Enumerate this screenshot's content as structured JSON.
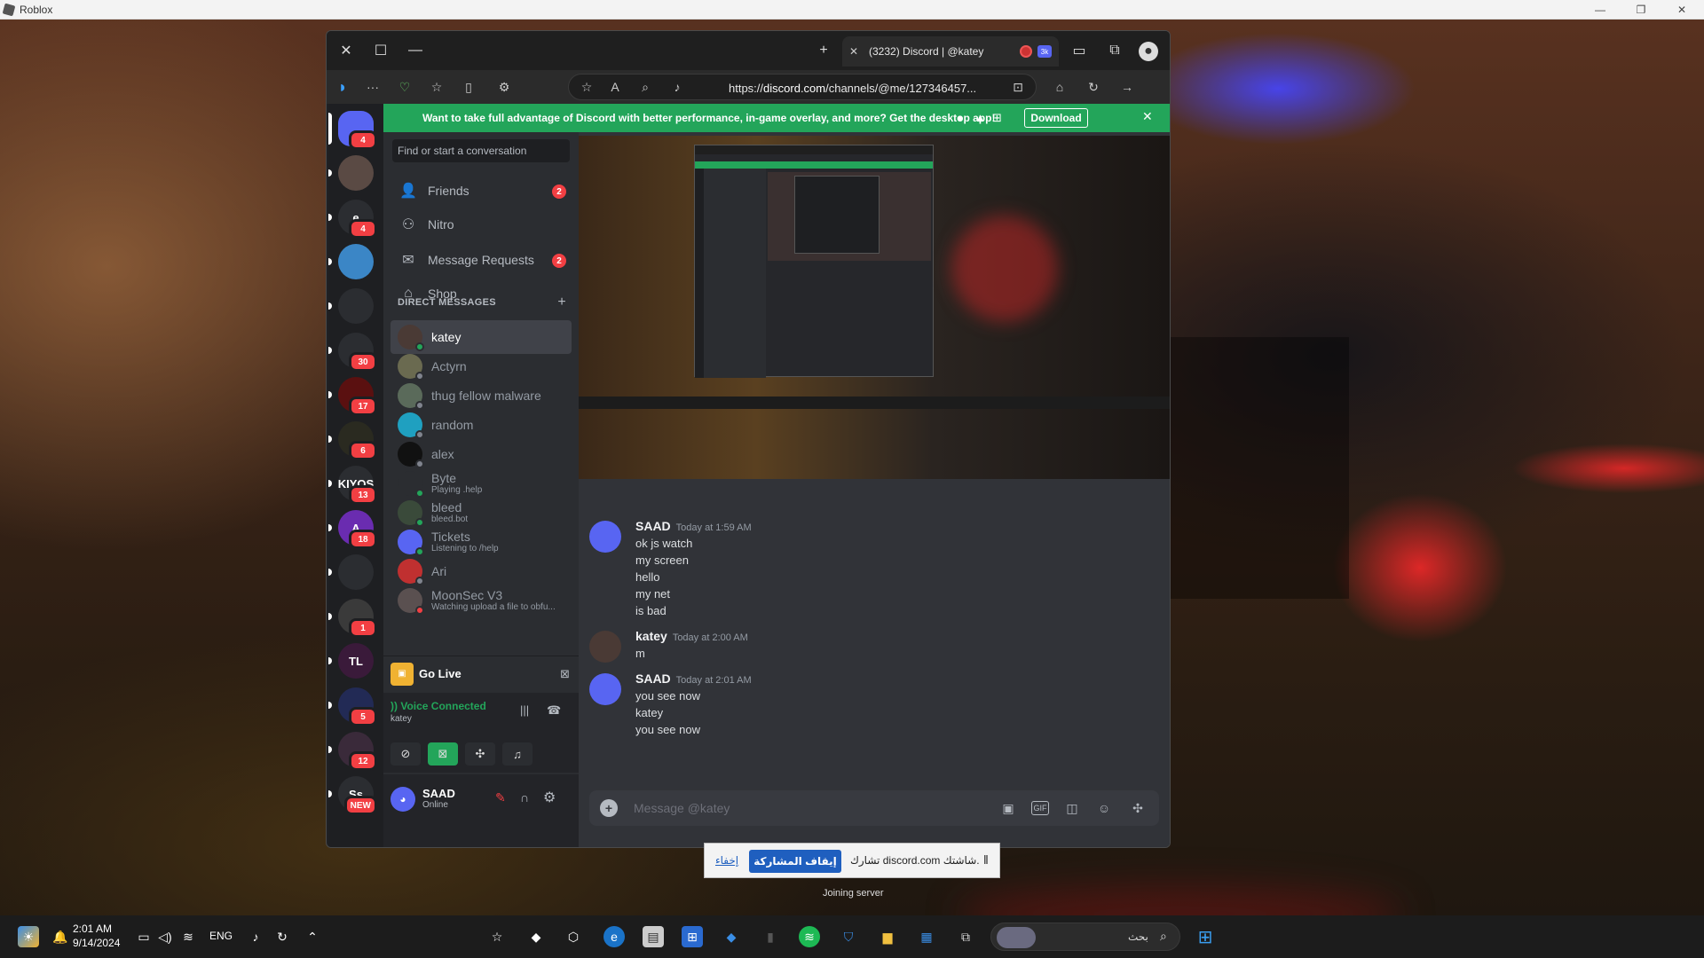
{
  "roblox": {
    "title": "Roblox"
  },
  "browser": {
    "tab_title": "(3232) Discord | @katey",
    "url_prefix": "https://",
    "url_domain": "discord.com",
    "url_rest": "/channels/@me/127346457..."
  },
  "banner": {
    "text": "Want to take full advantage of Discord with better performance, in-game overlay, and more? Get the desktop app!",
    "download": "Download"
  },
  "guilds": [
    {
      "label": "",
      "badge": "4",
      "color": "#5865f2"
    },
    {
      "label": "",
      "badge": "",
      "color": "#5a4a44"
    },
    {
      "label": "e",
      "badge": "4",
      "color": "#2b2d31"
    },
    {
      "label": "",
      "badge": "",
      "color": "#3b86c6"
    },
    {
      "label": "",
      "badge": "",
      "color": "#2b2d31"
    },
    {
      "label": "",
      "badge": "30",
      "color": "#2b2d31"
    },
    {
      "label": "",
      "badge": "17",
      "color": "#5a1010"
    },
    {
      "label": "",
      "badge": "6",
      "color": "#2a2a20"
    },
    {
      "label": "KIYOS",
      "badge": "13",
      "color": "#2b2d31"
    },
    {
      "label": "A",
      "badge": "18",
      "color": "#6a2cb0"
    },
    {
      "label": "",
      "badge": "",
      "color": "#2b2d31"
    },
    {
      "label": "",
      "badge": "1",
      "color": "#3a3a3a"
    },
    {
      "label": "TL",
      "badge": "",
      "color": "#3a1a3a"
    },
    {
      "label": "",
      "badge": "5",
      "color": "#222a55"
    },
    {
      "label": "",
      "badge": "12",
      "color": "#3a2a3a"
    },
    {
      "label": "Ss",
      "badge": "NEW",
      "color": "#2b2d31"
    }
  ],
  "sidebar": {
    "search_placeholder": "Find or start a conversation",
    "nav": [
      {
        "label": "Friends",
        "badge": "2"
      },
      {
        "label": "Nitro",
        "badge": ""
      },
      {
        "label": "Message Requests",
        "badge": "2"
      },
      {
        "label": "Shop",
        "badge": ""
      }
    ],
    "dm_header": "DIRECT MESSAGES",
    "dms": [
      {
        "name": "katey",
        "sub": "",
        "status": "#23a55a",
        "color": "#4a3a35"
      },
      {
        "name": "Actyrn",
        "sub": "",
        "status": "#80848e",
        "color": "#6a6a50"
      },
      {
        "name": "thug fellow malware",
        "sub": "",
        "status": "#80848e",
        "color": "#5a6a5a"
      },
      {
        "name": "random",
        "sub": "",
        "status": "#80848e",
        "color": "#1fa0c0"
      },
      {
        "name": "alex",
        "sub": "",
        "status": "#80848e",
        "color": "#111111"
      },
      {
        "name": "Byte",
        "sub": "Playing .help",
        "status": "#23a55a",
        "color": "#2b2d31"
      },
      {
        "name": "bleed",
        "sub": "bleed.bot",
        "status": "#23a55a",
        "color": "#3a4a3a"
      },
      {
        "name": "Tickets",
        "sub": "Listening to /help",
        "status": "#23a55a",
        "color": "#5865f2"
      },
      {
        "name": "Ari",
        "sub": "",
        "status": "#80848e",
        "color": "#c03030"
      },
      {
        "name": "MoonSec V3",
        "sub": "Watching upload a file to obfu...",
        "status": "#f23f43",
        "color": "#5a5050"
      }
    ],
    "golive": "Go Live",
    "voice_status": "Voice Connected",
    "voice_channel": "katey",
    "user_name": "SAAD",
    "user_status": "Online"
  },
  "messages": [
    {
      "author": "SAAD",
      "time": "Today at 1:59 AM",
      "lines": [
        "ok js watch",
        "my screen",
        "hello",
        "my net",
        "is bad"
      ]
    },
    {
      "author": "katey",
      "time": "Today at 2:00 AM",
      "lines": [
        "m"
      ]
    },
    {
      "author": "SAAD",
      "time": "Today at 2:01 AM",
      "lines": [
        "you see now",
        "katey",
        "you see now"
      ]
    }
  ],
  "composer": {
    "placeholder": "Message @katey"
  },
  "share": {
    "text": "تشارك discord.com شاشتك.",
    "stop": "إيقاف المشاركة",
    "hide": "إخفاء"
  },
  "joining": "Joining server",
  "taskbar": {
    "time": "2:01 AM",
    "date": "9/14/2024",
    "lang": "ENG",
    "search": "بحث"
  }
}
